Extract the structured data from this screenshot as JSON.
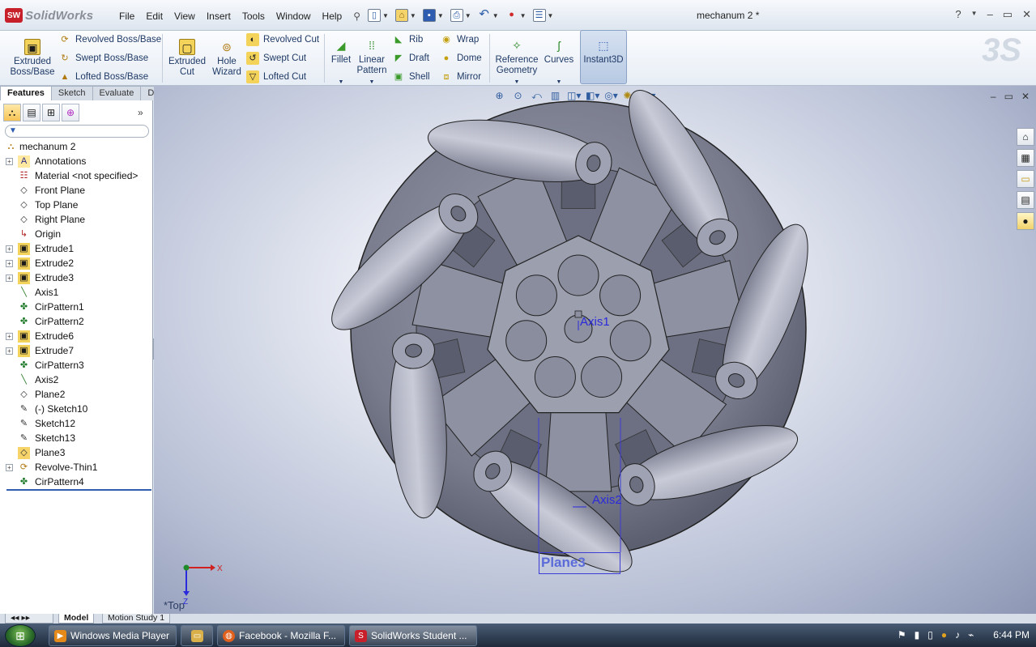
{
  "app": {
    "logo_badge": "SW",
    "logo_text": "SolidWorks",
    "document_title": "mechanum 2 *"
  },
  "menu": [
    "File",
    "Edit",
    "View",
    "Insert",
    "Tools",
    "Window",
    "Help"
  ],
  "window_controls": {
    "help": "?",
    "minimize": "–",
    "restore": "▭",
    "close": "✕"
  },
  "ribbon": {
    "extruded_boss": "Extruded\nBoss/Base",
    "revolved_boss": "Revolved Boss/Base",
    "swept_boss": "Swept Boss/Base",
    "lofted_boss": "Lofted Boss/Base",
    "extruded_cut": "Extruded\nCut",
    "hole_wizard": "Hole\nWizard",
    "revolved_cut": "Revolved Cut",
    "swept_cut": "Swept Cut",
    "lofted_cut": "Lofted Cut",
    "fillet": "Fillet",
    "linear_pattern": "Linear\nPattern",
    "rib": "Rib",
    "draft": "Draft",
    "shell": "Shell",
    "wrap": "Wrap",
    "dome": "Dome",
    "mirror": "Mirror",
    "reference_geometry": "Reference\nGeometry",
    "curves": "Curves",
    "instant3d": "Instant3D"
  },
  "command_tabs": [
    "Features",
    "Sketch",
    "Evaluate",
    "DimXpert"
  ],
  "feature_tree": {
    "root": "mechanum 2",
    "items": [
      {
        "label": "Annotations",
        "icon": "annotations-icon",
        "expandable": true
      },
      {
        "label": "Material <not specified>",
        "icon": "material-icon",
        "expandable": false
      },
      {
        "label": "Front Plane",
        "icon": "plane-icon",
        "expandable": false
      },
      {
        "label": "Top Plane",
        "icon": "plane-icon",
        "expandable": false
      },
      {
        "label": "Right Plane",
        "icon": "plane-icon",
        "expandable": false
      },
      {
        "label": "Origin",
        "icon": "origin-icon",
        "expandable": false
      },
      {
        "label": "Extrude1",
        "icon": "extrude-icon",
        "expandable": true
      },
      {
        "label": "Extrude2",
        "icon": "extrude-icon",
        "expandable": true
      },
      {
        "label": "Extrude3",
        "icon": "extrude-icon",
        "expandable": true
      },
      {
        "label": "Axis1",
        "icon": "axis-icon",
        "expandable": false
      },
      {
        "label": "CirPattern1",
        "icon": "pattern-icon",
        "expandable": false
      },
      {
        "label": "CirPattern2",
        "icon": "pattern-icon",
        "expandable": false
      },
      {
        "label": "Extrude6",
        "icon": "extrude-icon",
        "expandable": true
      },
      {
        "label": "Extrude7",
        "icon": "extrude-icon",
        "expandable": true
      },
      {
        "label": "CirPattern3",
        "icon": "pattern-icon",
        "expandable": false
      },
      {
        "label": "Axis2",
        "icon": "axis-icon",
        "expandable": false
      },
      {
        "label": "Plane2",
        "icon": "plane-icon",
        "expandable": false
      },
      {
        "label": "(-) Sketch10",
        "icon": "sketch-icon",
        "expandable": false
      },
      {
        "label": "Sketch12",
        "icon": "sketch-icon",
        "expandable": false
      },
      {
        "label": "Sketch13",
        "icon": "sketch-icon",
        "expandable": false
      },
      {
        "label": "Plane3",
        "icon": "plane-selected-icon",
        "expandable": false
      },
      {
        "label": "Revolve-Thin1",
        "icon": "revolve-icon",
        "expandable": true
      },
      {
        "label": "CirPattern4",
        "icon": "pattern-icon",
        "expandable": false
      }
    ]
  },
  "viewport": {
    "axis1_label": "Axis1",
    "axis2_label": "Axis2",
    "plane3_label": "Plane3",
    "view_name": "*Top",
    "triad_x": "X",
    "triad_z": "Z"
  },
  "bottom_tabs": [
    "Model",
    "Motion Study 1"
  ],
  "taskbar": {
    "start": "⊞",
    "buttons": [
      {
        "label": "Windows Media Player",
        "icon": "media-player-icon"
      },
      {
        "label": "",
        "icon": "explorer-icon"
      },
      {
        "label": "Facebook - Mozilla F...",
        "icon": "firefox-icon"
      },
      {
        "label": "SolidWorks Student ...",
        "icon": "solidworks-icon"
      }
    ],
    "clock": "6:44 PM"
  },
  "colors": {
    "sw_red": "#c8202b",
    "model_gray": "#7c7f8d",
    "axis_blue": "#2a2adc",
    "highlight": "#f6c455"
  }
}
